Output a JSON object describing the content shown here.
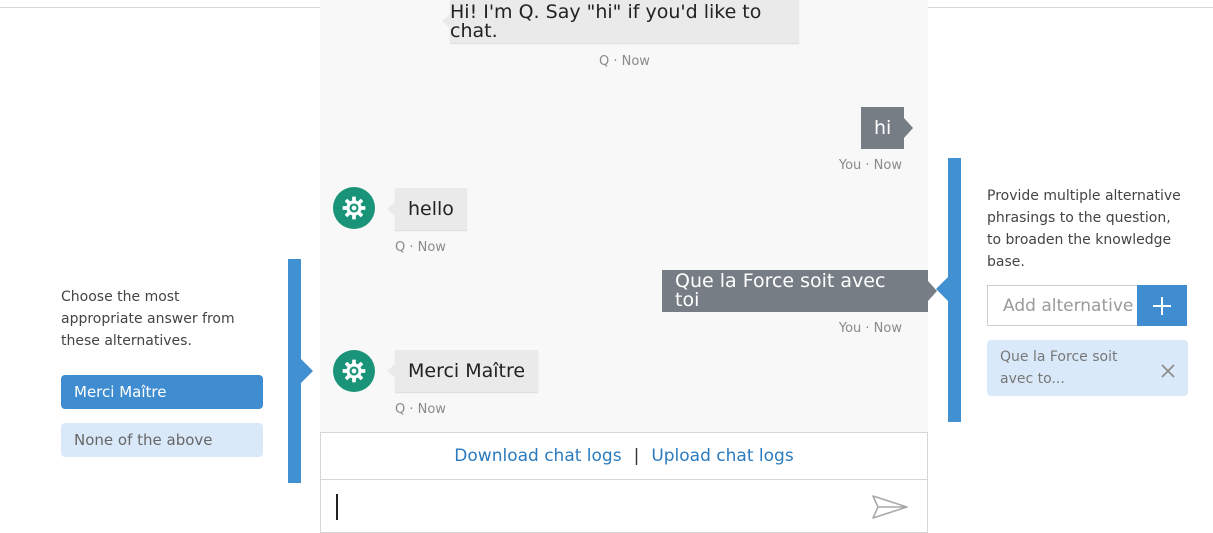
{
  "chat": {
    "messages": [
      {
        "sender": "bot",
        "text": "Hi! I'm Q. Say \"hi\" if you'd like to chat.",
        "meta": "Q · Now"
      },
      {
        "sender": "user",
        "text": "hi",
        "meta": "You · Now"
      },
      {
        "sender": "bot",
        "text": "hello",
        "meta": "Q · Now"
      },
      {
        "sender": "user",
        "text": "Que la Force soit avec toi",
        "meta": "You · Now"
      },
      {
        "sender": "bot",
        "text": "Merci Maître",
        "meta": "Q · Now"
      }
    ],
    "footer": {
      "download_label": "Download chat logs",
      "separator": "|",
      "upload_label": "Upload chat logs"
    },
    "input_value": "",
    "send_icon": "send-icon"
  },
  "left_panel": {
    "instruction": "Choose the most appropriate answer from these alternatives.",
    "options": [
      {
        "label": "Merci Maître",
        "selected": true
      },
      {
        "label": "None of the above",
        "selected": false
      }
    ]
  },
  "right_panel": {
    "instruction": "Provide multiple alternative phrasings to the question, to broaden the knowledge base.",
    "input_placeholder": "Add alternative",
    "add_icon": "plus-icon",
    "alternatives": [
      {
        "text": "Que la Force soit avec to...",
        "remove_icon": "close-icon"
      }
    ]
  },
  "colors": {
    "accent": "#3f8dd0",
    "bot_avatar": "#199479",
    "user_bubble": "#767d84",
    "bot_bubble": "#eaeaea",
    "light_option": "#dae9f9",
    "link": "#2b7bbf"
  }
}
